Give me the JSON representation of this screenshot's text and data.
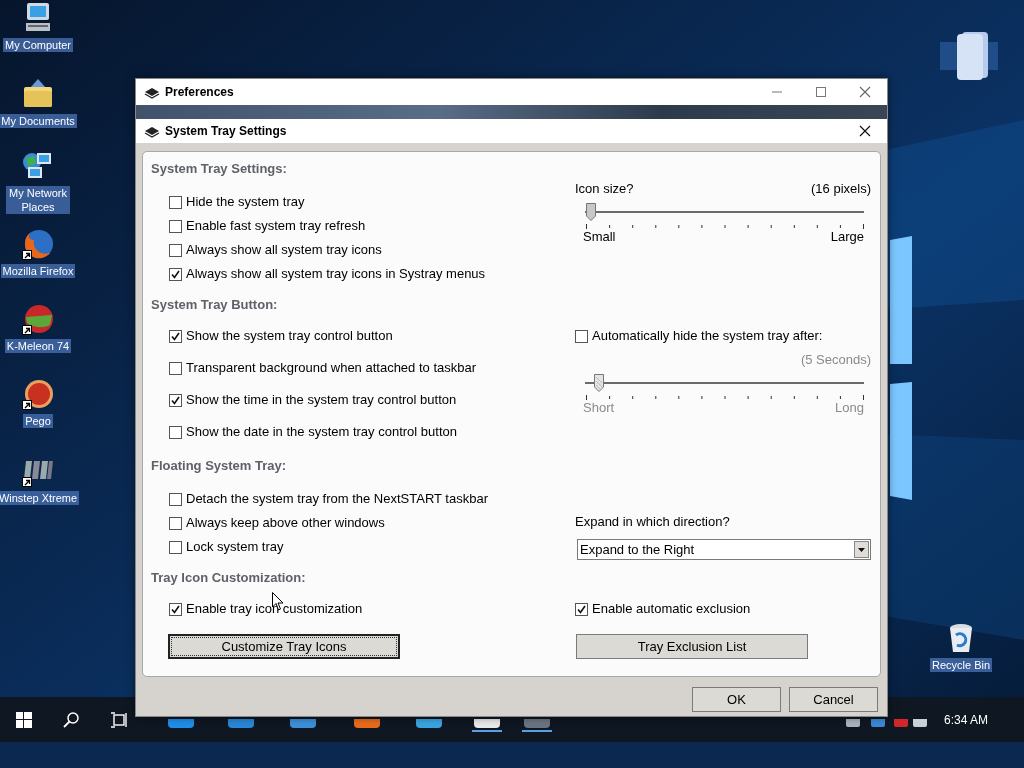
{
  "desktop_icons": [
    {
      "label": "My Computer",
      "shortcut": false
    },
    {
      "label": "My Documents",
      "shortcut": false
    },
    {
      "label": "My Network Places",
      "shortcut": false
    },
    {
      "label": "Mozilla Firefox",
      "shortcut": true
    },
    {
      "label": "K-Meleon 74",
      "shortcut": true
    },
    {
      "label": "Pego",
      "shortcut": true
    },
    {
      "label": "Winstep Xtreme",
      "shortcut": true
    },
    {
      "label": "Recycle Bin",
      "shortcut": false
    }
  ],
  "preferences_window": {
    "title": "Preferences"
  },
  "dialog": {
    "title": "System Tray Settings",
    "sections": [
      {
        "title": "System Tray Settings:",
        "left": [
          {
            "kind": "checkbox",
            "label": "Hide the system tray",
            "checked": false
          },
          {
            "kind": "checkbox",
            "label": "Enable fast system tray refresh",
            "checked": false
          },
          {
            "kind": "checkbox",
            "label": "Always show all system tray icons",
            "checked": false
          },
          {
            "kind": "checkbox",
            "label": "Always show all system tray icons in Systray menus",
            "checked": true
          }
        ],
        "right": [
          {
            "kind": "slider",
            "label": "Icon size?",
            "reading": "(16 pixels)",
            "level": 0.02,
            "min_label": "Small",
            "max_label": "Large",
            "disabled": false
          }
        ]
      },
      {
        "title": "System Tray Button:",
        "left": [
          {
            "kind": "checkbox",
            "label": "Show the system tray control button",
            "checked": true
          },
          {
            "kind": "checkbox",
            "label": "Transparent background when attached to taskbar",
            "checked": false
          },
          {
            "kind": "checkbox",
            "label": "Show the time in the system tray control button",
            "checked": true
          },
          {
            "kind": "checkbox",
            "label": "Show the date in the system tray control button",
            "checked": false
          }
        ],
        "right": [
          {
            "kind": "checkbox",
            "label": "Automatically hide the system tray after:",
            "checked": false
          },
          {
            "kind": "slider",
            "reading": "(5 Seconds)",
            "level": 0.05,
            "min_label": "Short",
            "max_label": "Long",
            "disabled": true
          }
        ]
      },
      {
        "title": "Floating System Tray:",
        "left": [
          {
            "kind": "checkbox",
            "label": "Detach the system tray from the NextSTART taskbar",
            "checked": false
          },
          {
            "kind": "checkbox",
            "label": "Always keep above other windows",
            "checked": false
          },
          {
            "kind": "checkbox",
            "label": "Lock system tray",
            "checked": false
          }
        ],
        "right": [
          {
            "kind": "dropdown",
            "label": "Expand in which direction?",
            "value": "Expand to the Right"
          }
        ]
      },
      {
        "title": "Tray Icon Customization:",
        "left": [
          {
            "kind": "checkbox",
            "label": "Enable tray icon customization",
            "checked": true
          },
          {
            "kind": "button",
            "label": "Customize Tray Icons",
            "focused": true
          }
        ],
        "right": [
          {
            "kind": "checkbox",
            "label": "Enable automatic exclusion",
            "checked": true
          },
          {
            "kind": "button",
            "label": "Tray Exclusion List",
            "focused": false
          }
        ]
      }
    ],
    "buttons": [
      {
        "label": "OK"
      },
      {
        "label": "Cancel"
      }
    ]
  },
  "taskbar": {
    "clock": "6:34 AM"
  }
}
